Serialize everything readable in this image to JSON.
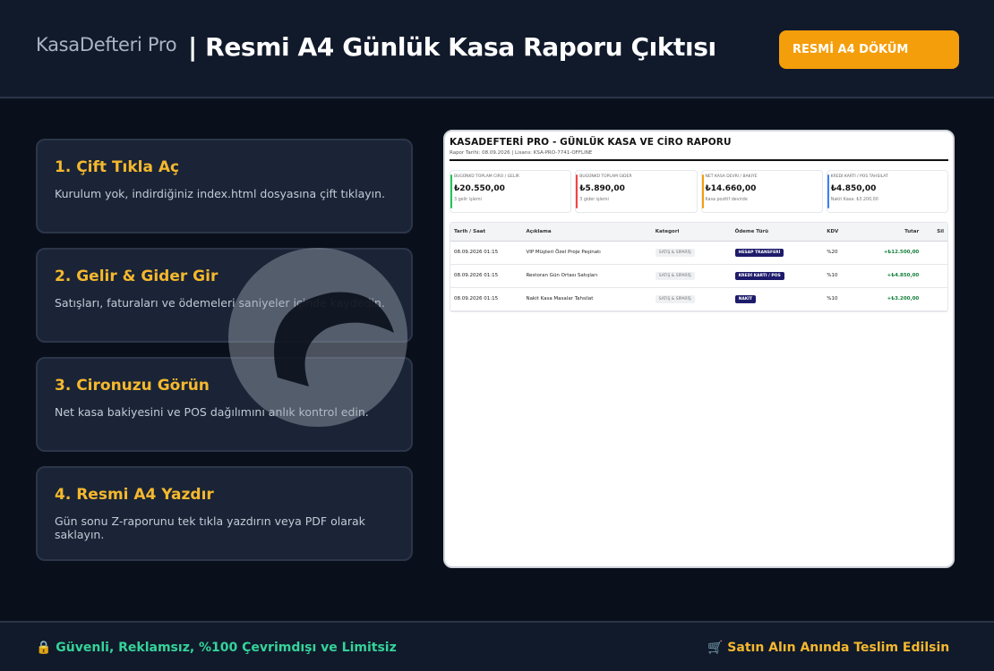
{
  "header": {
    "brand": "KasaDefteri Pro",
    "title": "| Resmi A4 Günlük Kasa Raporu Çıktısı",
    "button_label": "RESMİ A4 DÖKÜM"
  },
  "steps": [
    {
      "title": "1. Çift Tıkla Aç",
      "desc": "Kurulum yok, indirdiğiniz index.html dosyasına çift tıklayın."
    },
    {
      "title": "2. Gelir & Gider Gir",
      "desc": "Satışları, faturaları ve ödemeleri saniyeler içinde kaydedin."
    },
    {
      "title": "3. Cironuzu Görün",
      "desc": "Net kasa bakiyesini ve POS dağılımını anlık kontrol edin."
    },
    {
      "title": "4. Resmi A4 Yazdır",
      "desc": "Gün sonu Z-raporunu tek tıkla yazdırın veya PDF olarak saklayın."
    }
  ],
  "report": {
    "title": "KASADEFTERİ PRO - GÜNLÜK KASA VE CİRO RAPORU",
    "meta": "Rapor Tarihi: 08.09.2026 | Lisans: KSA-PRO-7741-OFFLINE",
    "cards": [
      {
        "label": "Bugünkü Toplam Ciro / Gelir",
        "value": "₺20.550,00",
        "note": "3 gelir işlemi",
        "color": "#22c55e"
      },
      {
        "label": "Bugünkü Toplam Gider",
        "value": "₺5.890,00",
        "note": "3 gider işlemi",
        "color": "#ef4444"
      },
      {
        "label": "Net Kasa Devri / Bakiye",
        "value": "₺14.660,00",
        "note": "Kasa pozitif devirde",
        "color": "#f59e0b"
      },
      {
        "label": "Kredi Kartı / POS Tahsilat",
        "value": "₺4.850,00",
        "note": "Nakit Kasa: ₺3.200,00",
        "color": "#3b82f6"
      }
    ],
    "columns": {
      "date": "Tarih / Saat",
      "desc": "Açıklama",
      "cat": "Kategori",
      "pay": "Ödeme Türü",
      "kdv": "KDV",
      "amount": "Tutar",
      "del": "Sil"
    },
    "rows": [
      {
        "date": "08.09.2026 01:15",
        "desc": "VIP Müşteri Özel Proje Peşinatı",
        "cat": "SATIŞ & SİPARİŞ",
        "pay": "HESAP TRANSFERİ",
        "kdv": "%20",
        "amount": "+₺12.500,00"
      },
      {
        "date": "08.09.2026 01:15",
        "desc": "Restoran Gün Ortası Satışları",
        "cat": "SATIŞ & SİPARİŞ",
        "pay": "KREDİ KARTI / POS",
        "kdv": "%10",
        "amount": "+₺4.850,00"
      },
      {
        "date": "08.09.2026 01:15",
        "desc": "Nakit Kasa Masalar Tahsilat",
        "cat": "SATIŞ & SİPARİŞ",
        "pay": "NAKİT",
        "kdv": "%10",
        "amount": "+₺3.200,00"
      }
    ]
  },
  "footer": {
    "left": "🔒 Güvenli, Reklamsız, %100 Çevrimdışı ve Limitsiz",
    "right": "🛒 Satın Alın Anında Teslim Edilsin"
  },
  "colors": {
    "accent": "#f59e0b",
    "step_title": "#f5b82e",
    "footer_green": "#34d399"
  }
}
